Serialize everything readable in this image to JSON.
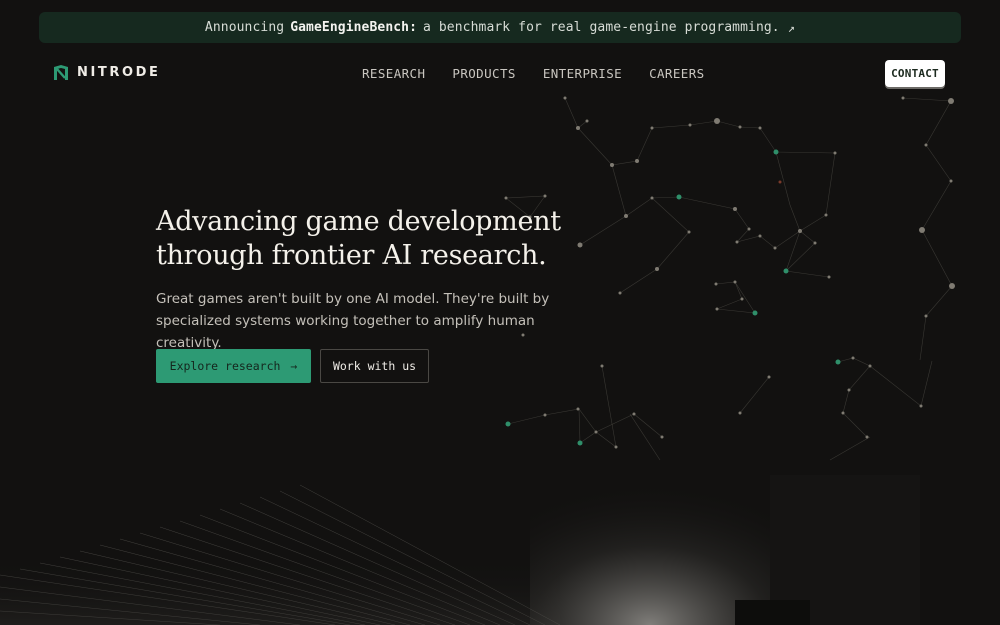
{
  "announcement": {
    "prefix": "Announcing",
    "highlight": "GameEngineBench:",
    "suffix": "a benchmark for real game-engine programming.",
    "arrow": "↗"
  },
  "brand": {
    "name": "NITRODE",
    "icon": "nitrode-logo-icon"
  },
  "nav": {
    "items": [
      {
        "label": "RESEARCH"
      },
      {
        "label": "PRODUCTS"
      },
      {
        "label": "ENTERPRISE"
      },
      {
        "label": "CAREERS"
      }
    ],
    "contact_label": "CONTACT"
  },
  "hero": {
    "title_line1": "Advancing game development",
    "title_line2": "through frontier AI research.",
    "subtitle_line1": "Great games aren't built by one AI model. They're built by",
    "subtitle_line2": "specialized systems working together to amplify human creativity.",
    "primary_cta": "Explore research",
    "primary_cta_arrow": "→",
    "secondary_cta": "Work with us"
  },
  "colors": {
    "background": "#121110",
    "announce_bg": "#16291f",
    "accent": "#2d9a74",
    "node_green": "#2f8f6a"
  }
}
